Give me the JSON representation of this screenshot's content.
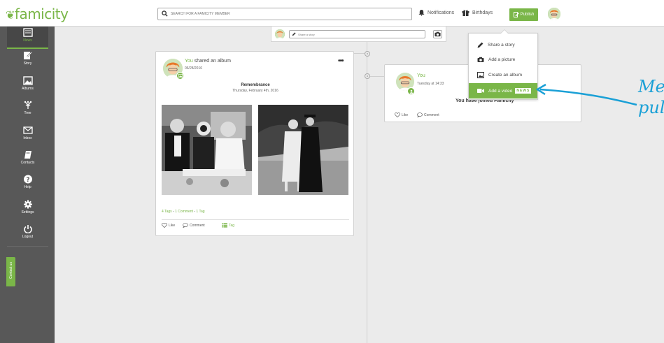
{
  "app": {
    "logo": "famicity"
  },
  "search": {
    "placeholder": "SEARCH FOR A FAMICITY MEMBER"
  },
  "header": {
    "notifications": "Notifications",
    "birthdays": "Birthdays",
    "publish": "Publish"
  },
  "sidebar": {
    "items": [
      {
        "label": "News",
        "icon": "news-icon"
      },
      {
        "label": "Story",
        "icon": "story-icon"
      },
      {
        "label": "Albums",
        "icon": "albums-icon"
      },
      {
        "label": "Tree",
        "icon": "tree-icon"
      },
      {
        "label": "Inbox",
        "icon": "inbox-icon"
      },
      {
        "label": "Contacts",
        "icon": "contacts-icon"
      },
      {
        "label": "Help",
        "icon": "help-icon"
      },
      {
        "label": "Settings",
        "icon": "settings-icon"
      },
      {
        "label": "Logout",
        "icon": "logout-icon"
      }
    ],
    "contact_tab": "Contact us"
  },
  "share_bar": {
    "placeholder": "Share a story"
  },
  "album_post": {
    "author": "You",
    "action": "shared an album",
    "date": "06/28/2016",
    "title": "Remembrance",
    "subtitle": "Thursday, February 4th, 2016",
    "tags_count": "4 Tags",
    "comments_count": "1 Comment",
    "tag_count": "1 Tag",
    "sep": "-",
    "like": "Like",
    "comment": "Comment",
    "tag": "Tag"
  },
  "joined_post": {
    "author": "You",
    "time": "Tuesday at 14:33",
    "message": "You have joined Famicity",
    "like": "Like",
    "comment": "Comment"
  },
  "publish_menu": {
    "items": [
      "Share a story",
      "Add a picture",
      "Create an album",
      "Add a video"
    ],
    "new_badge": "NEWS"
  },
  "annotation": {
    "line1": "Me",
    "line2": "pul"
  },
  "colors": {
    "accent": "#7ab648",
    "sidebar": "#585858",
    "annotation": "#1aa0d6"
  }
}
